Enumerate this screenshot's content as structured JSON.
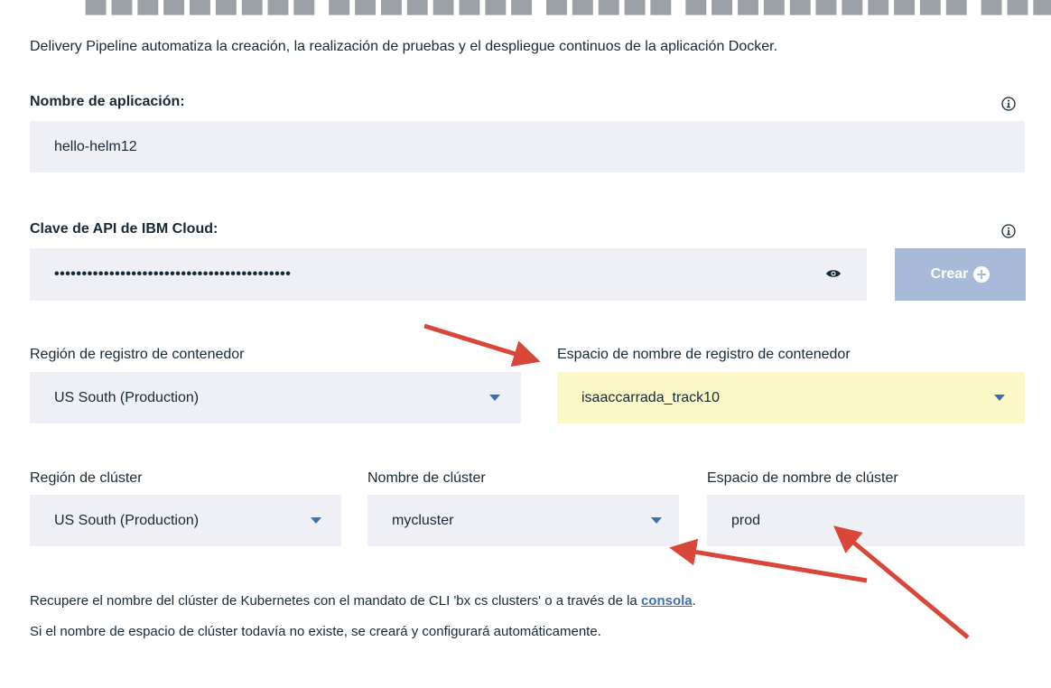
{
  "header_cut_text": "■■■■■■■■■ ■■■■■■■■ ■■■■■ ■■■■■■■■■■■ ■■■ ■■■■■■ ■■■■■■■■■■■■■ ■■■■■■■■",
  "description": "Delivery Pipeline automatiza la creación, la realización de pruebas y el despliegue continuos de la aplicación Docker.",
  "app_name": {
    "label": "Nombre de aplicación:",
    "value": "hello-helm12",
    "info_icon": "info-icon"
  },
  "api_key": {
    "label": "Clave de API de IBM Cloud:",
    "value": "•••••••••••••••••••••••••••••••••••••••••••",
    "reveal_icon": "eye-icon",
    "info_icon": "info-icon",
    "create_label": "Crear",
    "create_icon": "plus-circle-icon"
  },
  "registry_region": {
    "label": "Región de registro de contenedor",
    "value": "US South (Production)"
  },
  "registry_namespace": {
    "label": "Espacio de nombre de registro de contenedor",
    "value": "isaaccarrada_track10",
    "highlight_color": "#fcf8c8"
  },
  "cluster_region": {
    "label": "Región de clúster",
    "value": "US South (Production)"
  },
  "cluster_name": {
    "label": "Nombre de clúster",
    "value": "mycluster"
  },
  "cluster_namespace": {
    "label": "Espacio de nombre de clúster",
    "value": "prod"
  },
  "help": {
    "line1_prefix": "Recupere el nombre del clúster de Kubernetes con el mandato de CLI 'bx cs clusters' o a través de la ",
    "line1_link": "consola",
    "line1_suffix": ".",
    "line2": "Si el nombre de espacio de clúster todavía no existe, se creará y configurará automáticamente."
  },
  "colors": {
    "field_bg": "#eef0f5",
    "accent": "#3d70b2",
    "button_disabled": "#a7bbd8",
    "annotation_arrow": "#d9463a"
  }
}
